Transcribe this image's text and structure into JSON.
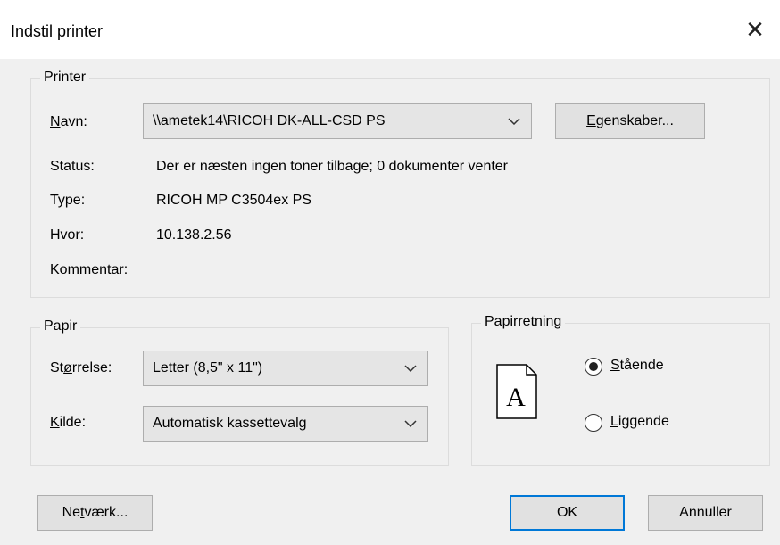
{
  "dialog": {
    "title": "Indstil printer",
    "close_glyph": "✕"
  },
  "printer": {
    "group_label": "Printer",
    "name_label_u": "N",
    "name_label_rest": "avn:",
    "name_value": "\\\\ametek14\\RICOH DK-ALL-CSD PS",
    "properties_button_u": "E",
    "properties_button_rest": "genskaber...",
    "status_label": "Status:",
    "status_value": "Der er næsten ingen toner tilbage; 0 dokumenter venter",
    "type_label": "Type:",
    "type_value": "RICOH MP C3504ex PS",
    "where_label": "Hvor:",
    "where_value": "10.138.2.56",
    "comment_label": "Kommentar:",
    "comment_value": ""
  },
  "paper": {
    "group_label": "Papir",
    "size_label_pre": "St",
    "size_label_u": "ø",
    "size_label_rest": "rrelse:",
    "size_value": "Letter (8,5\" x 11\")",
    "source_label_u": "K",
    "source_label_rest": "ilde:",
    "source_value": "Automatisk kassettevalg"
  },
  "orientation": {
    "group_label": "Papirretning",
    "icon_letter": "A",
    "portrait_u": "S",
    "portrait_rest": "tående",
    "landscape_u": "L",
    "landscape_rest": "iggende",
    "selected": "portrait"
  },
  "footer": {
    "network_pre": "Ne",
    "network_u": "t",
    "network_rest": "værk...",
    "ok_label": "OK",
    "cancel_label": "Annuller"
  },
  "colors": {
    "default_button_border": "#0078d7",
    "button_face": "#e1e1e1",
    "dialog_bg": "#f0f0f0"
  }
}
